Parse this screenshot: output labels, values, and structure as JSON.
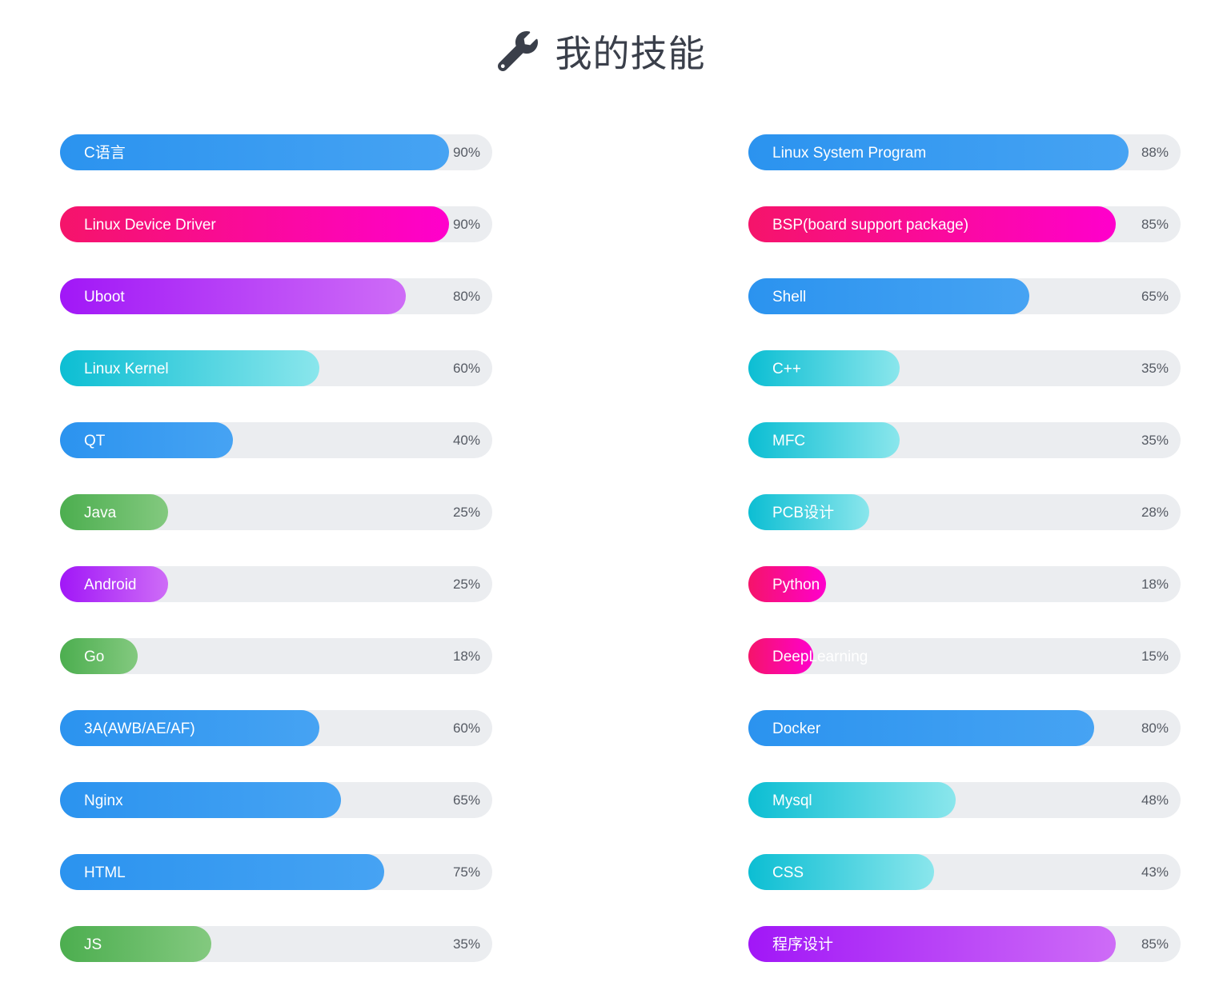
{
  "header": {
    "icon": "wrench-icon",
    "title": "我的技能"
  },
  "colors": {
    "blue": "#2b93ef",
    "pink": "#f5146a",
    "purple": "#a117f7",
    "cyan": "#0cbed3",
    "green": "#4cae4f",
    "track": "#ebedf0"
  },
  "skills_left": [
    {
      "label": "C语言",
      "percent": "90%",
      "value": 90,
      "color": "blue"
    },
    {
      "label": "Linux Device Driver",
      "percent": "90%",
      "value": 90,
      "color": "pink"
    },
    {
      "label": "Uboot",
      "percent": "80%",
      "value": 80,
      "color": "purple"
    },
    {
      "label": "Linux Kernel",
      "percent": "60%",
      "value": 60,
      "color": "cyan"
    },
    {
      "label": "QT",
      "percent": "40%",
      "value": 40,
      "color": "blue"
    },
    {
      "label": "Java",
      "percent": "25%",
      "value": 25,
      "color": "green"
    },
    {
      "label": "Android",
      "percent": "25%",
      "value": 25,
      "color": "purple"
    },
    {
      "label": "Go",
      "percent": "18%",
      "value": 18,
      "color": "green"
    },
    {
      "label": "3A(AWB/AE/AF)",
      "percent": "60%",
      "value": 60,
      "color": "blue"
    },
    {
      "label": "Nginx",
      "percent": "65%",
      "value": 65,
      "color": "blue"
    },
    {
      "label": "HTML",
      "percent": "75%",
      "value": 75,
      "color": "blue"
    },
    {
      "label": "JS",
      "percent": "35%",
      "value": 35,
      "color": "green"
    }
  ],
  "skills_right": [
    {
      "label": "Linux System Program",
      "percent": "88%",
      "value": 88,
      "color": "blue"
    },
    {
      "label": "BSP(board support package)",
      "percent": "85%",
      "value": 85,
      "color": "pink"
    },
    {
      "label": "Shell",
      "percent": "65%",
      "value": 65,
      "color": "blue"
    },
    {
      "label": "C++",
      "percent": "35%",
      "value": 35,
      "color": "cyan"
    },
    {
      "label": "MFC",
      "percent": "35%",
      "value": 35,
      "color": "cyan"
    },
    {
      "label": "PCB设计",
      "percent": "28%",
      "value": 28,
      "color": "cyan"
    },
    {
      "label": "Python",
      "percent": "18%",
      "value": 18,
      "color": "pink"
    },
    {
      "label": "DeepLearning",
      "percent": "15%",
      "value": 15,
      "color": "pink"
    },
    {
      "label": "Docker",
      "percent": "80%",
      "value": 80,
      "color": "blue"
    },
    {
      "label": "Mysql",
      "percent": "48%",
      "value": 48,
      "color": "cyan"
    },
    {
      "label": "CSS",
      "percent": "43%",
      "value": 43,
      "color": "cyan"
    },
    {
      "label": "程序设计",
      "percent": "85%",
      "value": 85,
      "color": "purple"
    }
  ]
}
